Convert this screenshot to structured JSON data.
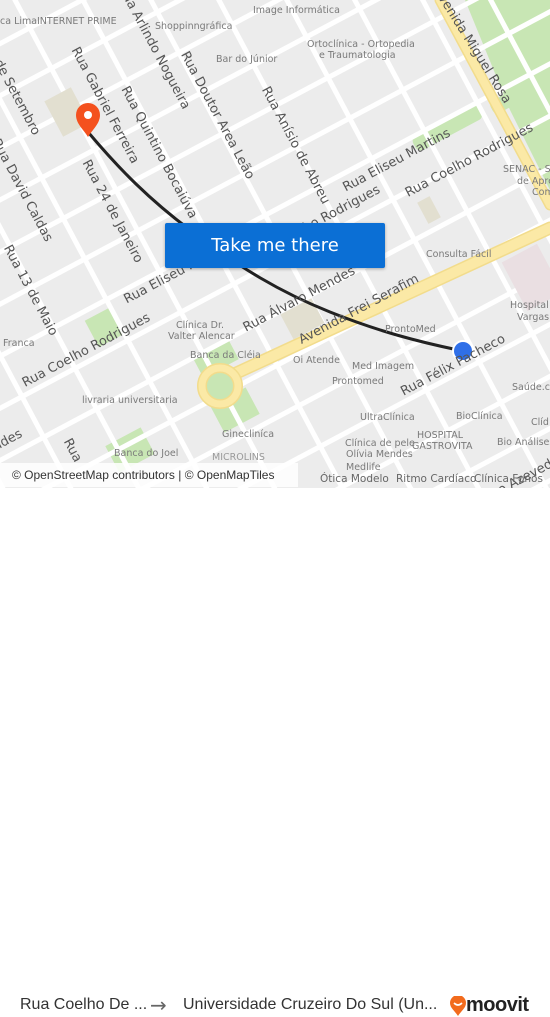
{
  "map": {
    "streets": [
      "Rua Arlindo Nogueira",
      "Rua Gabriel Ferreira",
      "Rua Quintino Bocaiúva",
      "Rua Doutor Area Leão",
      "Rua Anísio de Abreu",
      "Rua 24 de Janeiro",
      "Rua 13 de Maio",
      "Rua David Caldas",
      "de Setembro",
      "Rua Eliseu Martins",
      "Rua Coelho Rodrigues",
      "Rua Eliseu Martins",
      "Rua Coelho Rodrigues",
      "Rua Coelho Rodrigues",
      "Rua Álvaro Mendes",
      "Avenida Frei Serafim",
      "Rua Félix Pacheco",
      "Avenida Miguel Rosa",
      "Rua",
      "ndes",
      "o Azevedo"
    ],
    "pois": [
      "ca Lima",
      "INTERNET PRIME",
      "Shoppinngráfica",
      "Image Informática",
      "Bar do Júnior",
      "Ortoclínica - Ortopedia",
      "e Traumatologia",
      "SENAC - Ser",
      "de Apre",
      "Com",
      "Consulta Fácil",
      "Hospital G",
      "Vargas -",
      "Clínica Dr.",
      "Valter Alencar",
      "Banca da Cléia",
      "Franca",
      "livraria universitaria",
      "ProntoMed",
      "Oi Atende",
      "Med Imagem",
      "Prontomed",
      "UltraClínica",
      "BioClínica",
      "Saúde.co",
      "Clíd",
      "HOSPITAL",
      "GASTROVITA",
      "Clínica de pele",
      "Olívia Mendes",
      "Bio Análises",
      "Ginecliníca",
      "Banca do Joel",
      "Medlife",
      "Ótica Modelo",
      "Ritmo Cardíaco",
      "MICROLINS",
      "Clínica Fonos"
    ],
    "attribution": "© OpenStreetMap contributors | © OpenMapTiles",
    "cta_label": "Take me there",
    "colors": {
      "route": "#222222",
      "destination_pin": "#f4511e",
      "origin_dot": "#2f6fe8",
      "cta": "#0b6fd5",
      "avenue": "#fbe9a6",
      "park": "#c8e6b4"
    }
  },
  "footer": {
    "from": "Rua Coelho De ...",
    "arrow": "→",
    "to": "Universidade Cruzeiro Do Sul (Un...",
    "brand": "moovit"
  }
}
